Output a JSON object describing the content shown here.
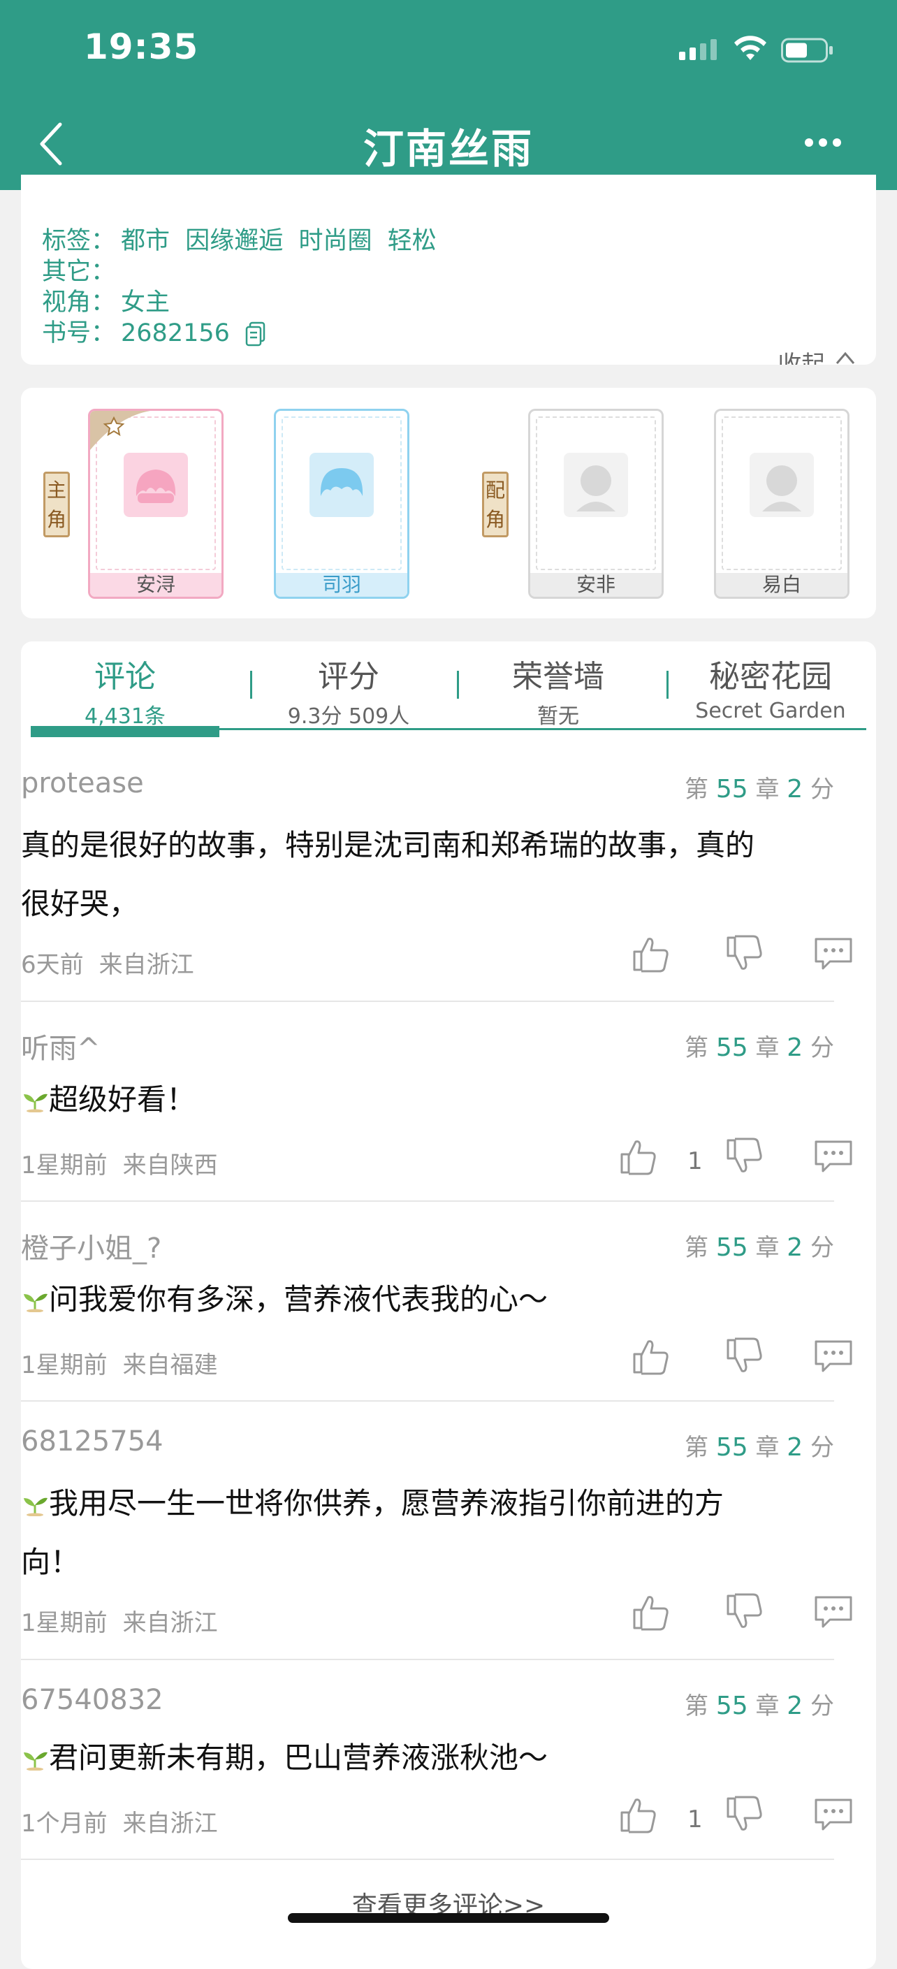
{
  "status_bar": {
    "time": "19:35"
  },
  "header": {
    "title": "汀南丝雨"
  },
  "info": {
    "collapse_label": "收起",
    "rows": [
      {
        "label": "标签：",
        "value": "都市  因缘邂逅  时尚圈  轻松"
      },
      {
        "label": "其它：",
        "value": ""
      },
      {
        "label": "视角：",
        "value": "女主"
      },
      {
        "label": "书号：",
        "value": "2682156"
      }
    ]
  },
  "characters": {
    "main_tag": "主角",
    "support_tag": "配角",
    "list": [
      {
        "name": "安浔",
        "color": "#f6a5c0"
      },
      {
        "name": "司羽",
        "color": "#7ccaef"
      },
      {
        "name": "安非",
        "color": "#bbbbbb"
      },
      {
        "name": "易白",
        "color": "#bbbbbb"
      }
    ]
  },
  "tabs": [
    {
      "label": "评论",
      "sub": "4,431条"
    },
    {
      "label": "评分",
      "sub": "9.3分 509人"
    },
    {
      "label": "荣誉墙",
      "sub": "暂无"
    },
    {
      "label": "秘密花园",
      "sub": "Secret Garden"
    }
  ],
  "comments": [
    {
      "user": "protease",
      "chapter_pre": "第",
      "chapter": "55",
      "chapter_mid": "章",
      "score": "2",
      "score_unit": "分",
      "line1": "真的是很好的故事，特别是沈司南和郑希瑞的故事，真的",
      "line2": "很好哭，",
      "time": "6天前",
      "location": "来自浙江",
      "likes": ""
    },
    {
      "user": "听雨^",
      "chapter_pre": "第",
      "chapter": "55",
      "chapter_mid": "章",
      "score": "2",
      "score_unit": "分",
      "line1": "超级好看！",
      "line2": "",
      "time": "1星期前",
      "location": "来自陕西",
      "likes": "1"
    },
    {
      "user": "橙子小姐_?",
      "chapter_pre": "第",
      "chapter": "55",
      "chapter_mid": "章",
      "score": "2",
      "score_unit": "分",
      "line1": "问我爱你有多深，营养液代表我的心～",
      "line2": "",
      "time": "1星期前",
      "location": "来自福建",
      "likes": ""
    },
    {
      "user": "68125754",
      "chapter_pre": "第",
      "chapter": "55",
      "chapter_mid": "章",
      "score": "2",
      "score_unit": "分",
      "line1": "我用尽一生一世将你供养，愿营养液指引你前进的方",
      "line2": "向！",
      "time": "1星期前",
      "location": "来自浙江",
      "likes": ""
    },
    {
      "user": "67540832",
      "chapter_pre": "第",
      "chapter": "55",
      "chapter_mid": "章",
      "score": "2",
      "score_unit": "分",
      "line1": "君问更新未有期，巴山营养液涨秋池～",
      "line2": "",
      "time": "1个月前",
      "location": "来自浙江",
      "likes": "1"
    }
  ],
  "see_more": "查看更多评论>>",
  "colors": {
    "accent": "#2f9c87",
    "background": "#f1f1f1"
  },
  "icons": [
    "back-icon",
    "more-icon",
    "copy-icon",
    "thumbs-up-icon",
    "thumbs-down-icon",
    "reply-icon",
    "sprout-icon",
    "star-icon"
  ]
}
